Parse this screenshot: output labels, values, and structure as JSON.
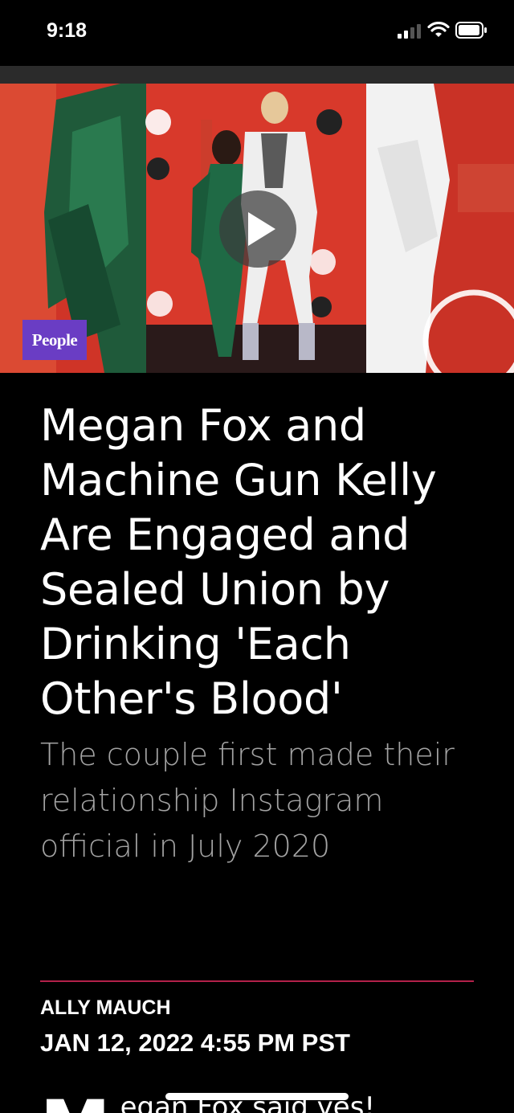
{
  "status_bar": {
    "time": "9:18",
    "icons": [
      "cellular-signal-icon",
      "wifi-icon",
      "battery-icon"
    ]
  },
  "hero": {
    "brand_label": "People",
    "play_icon": "play-icon"
  },
  "article": {
    "headline": "Megan Fox and Machine Gun Kelly Are Engaged and Sealed Union by Drinking 'Each Other's Blood'",
    "subheadline": "The couple first made their relationship Instagram official in July 2020",
    "author": "ALLY MAUCH",
    "date": "JAN 12, 2022 4:55 PM PST",
    "drop_cap": "M",
    "body_start": "egan Fox said yes!"
  },
  "colors": {
    "background": "#000000",
    "divider": "#b3214a",
    "subheadline": "#a3a3a3",
    "brand_badge": "#6a3dc4",
    "hero_red": "#d23a2c"
  }
}
